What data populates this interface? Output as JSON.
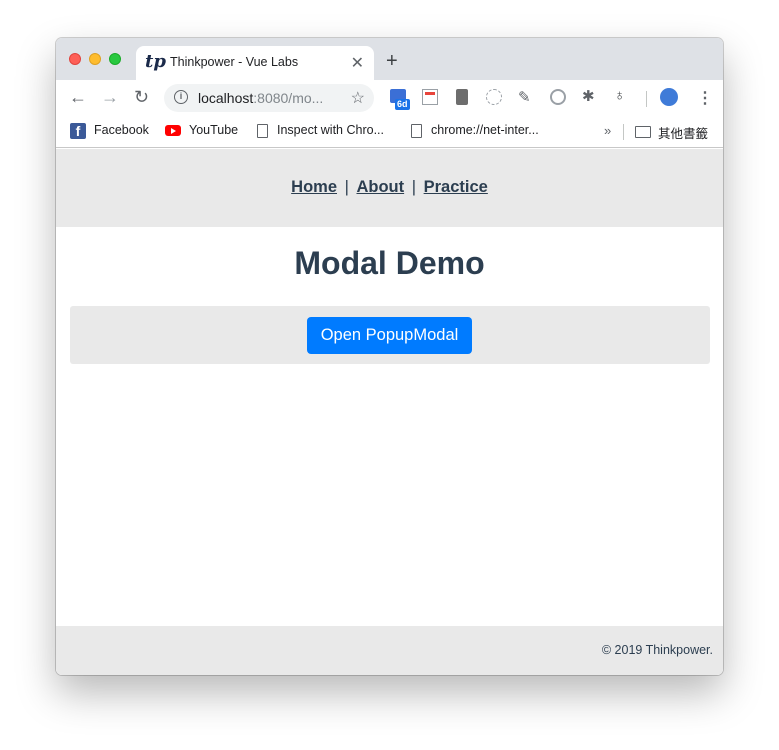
{
  "browser": {
    "tab": {
      "favicon_text": "tp",
      "title": "Thinkpower - Vue Labs",
      "close_glyph": "✕"
    },
    "new_tab_glyph": "+",
    "toolbar": {
      "back_glyph": "←",
      "forward_glyph": "→",
      "reload_glyph": "↻",
      "url_host": "localhost",
      "url_rest": ":8080/mo...",
      "star_glyph": "☆",
      "extension_badge": "6d",
      "menu_glyph": "⋮"
    },
    "bookmarks": [
      {
        "label": "Facebook",
        "icon": "facebook-icon"
      },
      {
        "label": "YouTube",
        "icon": "youtube-icon"
      },
      {
        "label": "Inspect with Chro...",
        "icon": "page-icon"
      },
      {
        "label": "chrome://net-inter...",
        "icon": "page-icon"
      }
    ],
    "bookmarks_overflow_glyph": "»",
    "other_bookmarks_label": "其他書籤"
  },
  "site": {
    "nav": {
      "home": "Home",
      "about": "About",
      "practice": "Practice",
      "separator": "|"
    },
    "title": "Modal Demo",
    "open_button_label": "Open PopupModal",
    "footer": "© 2019 Thinkpower."
  },
  "colors": {
    "primary_button": "#007bff",
    "heading": "#2c3e50",
    "band_background": "#e9e9e9"
  }
}
